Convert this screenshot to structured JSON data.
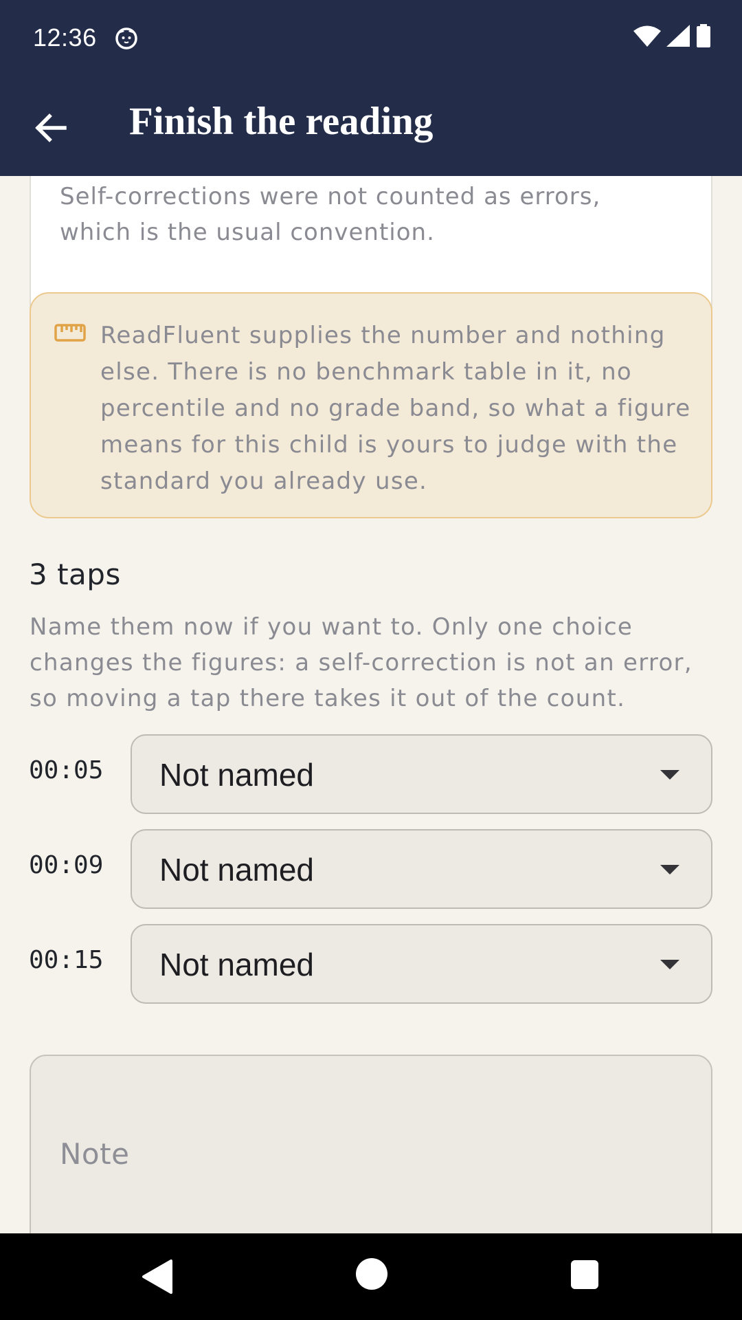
{
  "status_bar": {
    "time": "12:36",
    "app_icon": "cat-face-icon",
    "icons": [
      "wifi-icon",
      "signal-icon",
      "battery-icon"
    ]
  },
  "app_bar": {
    "back_icon": "arrow-left-icon",
    "title": "Finish the reading"
  },
  "method_card": {
    "text": "Self-corrections were not counted as errors, which is the usual convention."
  },
  "notice_card": {
    "icon": "ruler-icon",
    "text": "ReadFluent supplies the number and nothing else. There is no benchmark table in it, no percentile and no grade band, so what a figure means for this child is yours to judge with the standard you already use."
  },
  "taps": {
    "heading": "3 taps",
    "description": "Name them now if you want to. Only one choice changes the figures: a self-correction is not an error, so moving a tap there takes it out of the count.",
    "rows": [
      {
        "time": "00:05",
        "value": "Not named"
      },
      {
        "time": "00:09",
        "value": "Not named"
      },
      {
        "time": "00:15",
        "value": "Not named"
      }
    ]
  },
  "note": {
    "placeholder": "Note"
  },
  "nav_bar": {
    "icons": [
      "nav-back-icon",
      "nav-home-icon",
      "nav-recents-icon"
    ]
  },
  "colors": {
    "app_bar": "#232d49",
    "background": "#f5f3ec",
    "notice_background": "#f4ead8",
    "notice_border": "#ecc98e",
    "ruler_icon": "#e0a347"
  }
}
